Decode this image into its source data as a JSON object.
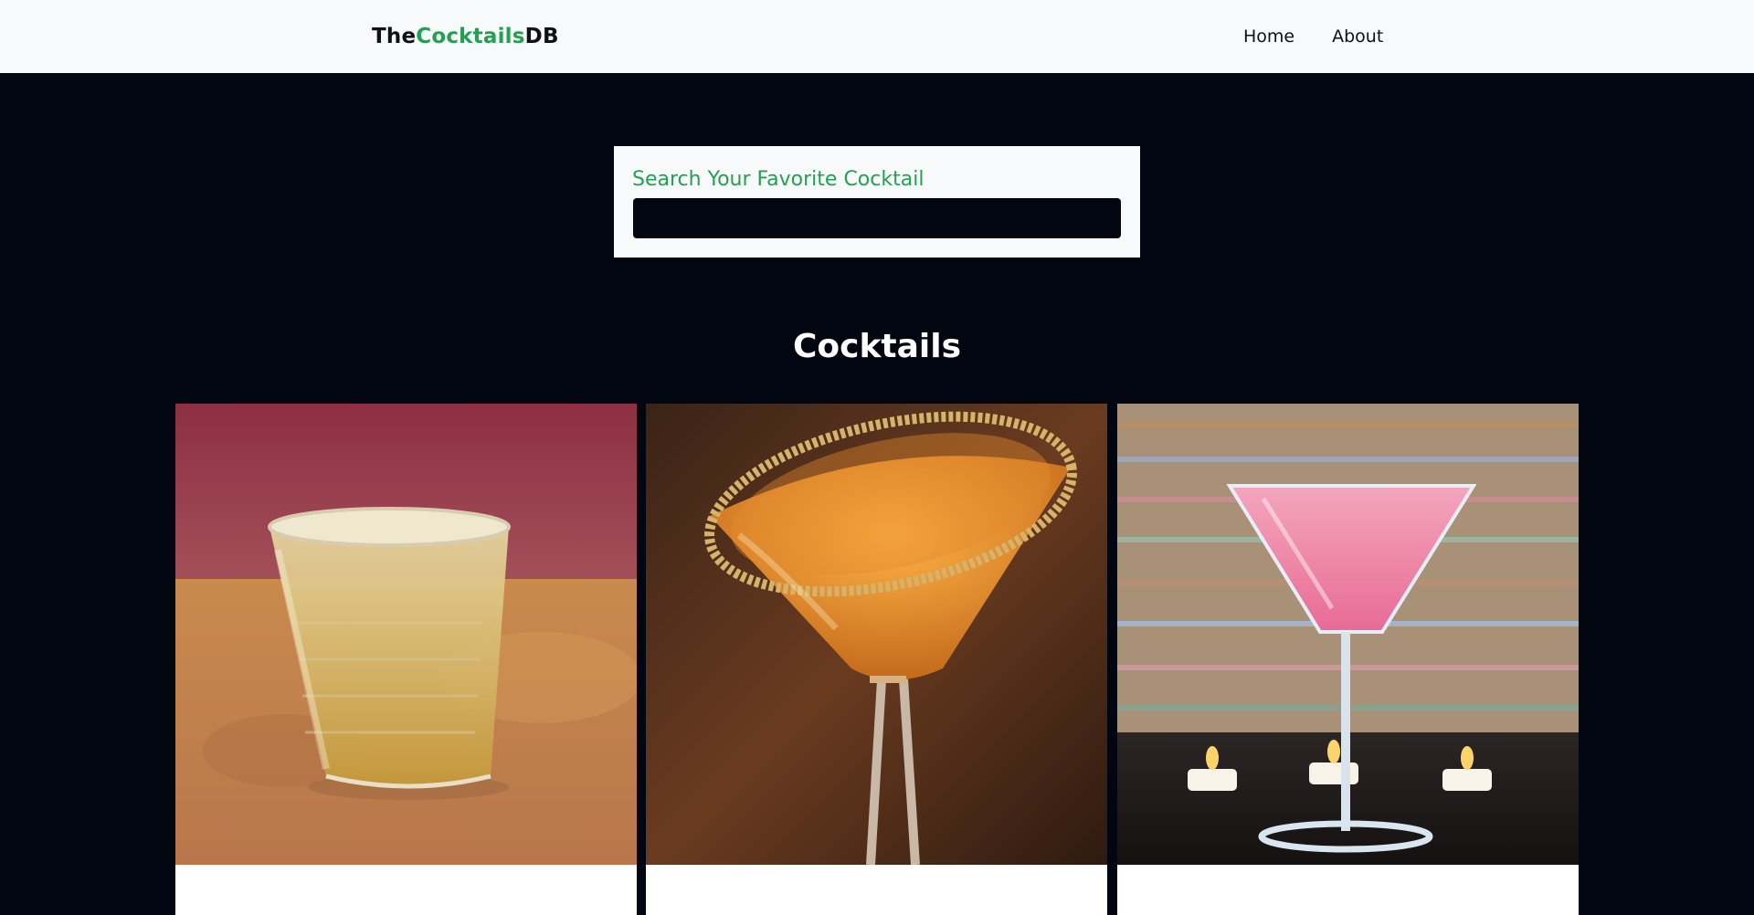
{
  "navbar": {
    "logo": {
      "part1": "The",
      "part2": "Cocktails",
      "part3": "DB"
    },
    "links": [
      "Home",
      "About"
    ]
  },
  "search": {
    "label": "Search Your Favorite Cocktail",
    "value": ""
  },
  "section": {
    "title": "Cocktails"
  },
  "cards": [
    {
      "image": "glass-of-yellow-cocktail-on-ice"
    },
    {
      "image": "orange-martini-with-sugar-rim"
    },
    {
      "image": "pink-cocktail-in-martini-glass-with-candles"
    }
  ],
  "colors": {
    "accent": "#24a052",
    "background": "#020611",
    "navbar": "#f8f9fb"
  }
}
